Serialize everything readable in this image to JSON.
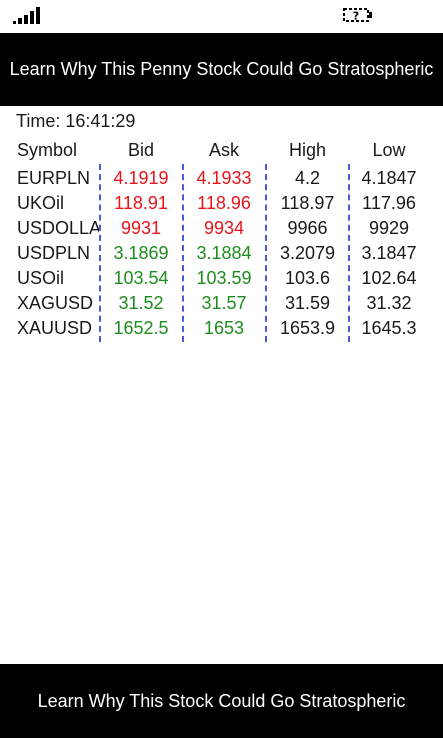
{
  "status_bar": {
    "signal_icon": "signal-strength-icon",
    "battery_icon": "battery-unknown-icon",
    "battery_label": "?"
  },
  "ads": {
    "top": "Learn Why This Penny Stock Could Go Stratospheric",
    "bottom": "Learn Why This Stock Could Go Stratospheric"
  },
  "quotes": {
    "time_label": "Time:",
    "time_value": "16:41:29",
    "headers": {
      "symbol": "Symbol",
      "bid": "Bid",
      "ask": "Ask",
      "high": "High",
      "low": "Low"
    },
    "colors": {
      "down": "#e8141b",
      "up": "#1e8c1e",
      "neutral": "#1a1a1a",
      "divider": "#4a5ad8"
    },
    "rows": [
      {
        "symbol": "EURPLN",
        "bid": "4.1919",
        "ask": "4.1933",
        "high": "4.2",
        "low": "4.1847",
        "trend": "down"
      },
      {
        "symbol": "UKOil",
        "bid": "118.91",
        "ask": "118.96",
        "high": "118.97",
        "low": "117.96",
        "trend": "down"
      },
      {
        "symbol": "USDOLLAR",
        "bid": "9931",
        "ask": "9934",
        "high": "9966",
        "low": "9929",
        "trend": "down"
      },
      {
        "symbol": "USDPLN",
        "bid": "3.1869",
        "ask": "3.1884",
        "high": "3.2079",
        "low": "3.1847",
        "trend": "up"
      },
      {
        "symbol": "USOil",
        "bid": "103.54",
        "ask": "103.59",
        "high": "103.6",
        "low": "102.64",
        "trend": "up"
      },
      {
        "symbol": "XAGUSD",
        "bid": "31.52",
        "ask": "31.57",
        "high": "31.59",
        "low": "31.32",
        "trend": "up"
      },
      {
        "symbol": "XAUUSD",
        "bid": "1652.5",
        "ask": "1653",
        "high": "1653.9",
        "low": "1645.3",
        "trend": "up"
      }
    ]
  }
}
